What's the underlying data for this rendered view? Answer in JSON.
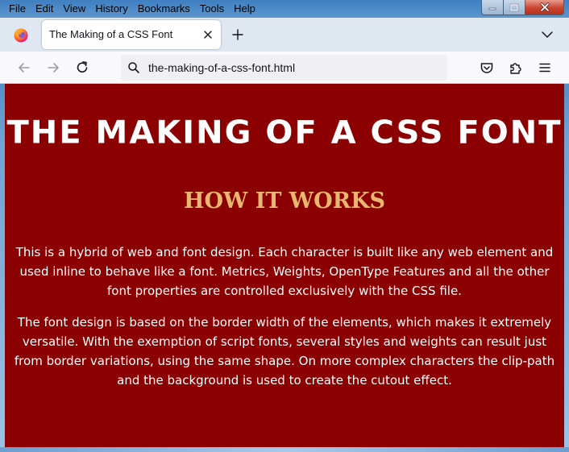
{
  "menu": {
    "items": [
      "File",
      "Edit",
      "View",
      "History",
      "Bookmarks",
      "Tools",
      "Help"
    ]
  },
  "window_controls": {
    "minimize_icon": "minimize-icon",
    "maximize_icon": "maximize-icon",
    "close_icon": "close-icon"
  },
  "tab": {
    "title": "The Making of a CSS Font",
    "close_icon": "close-icon"
  },
  "toolbar": {
    "new_tab_icon": "plus-icon",
    "list_all_tabs_icon": "chevron-down-icon",
    "back_icon": "arrow-left-icon",
    "forward_icon": "arrow-right-icon",
    "reload_icon": "reload-icon",
    "pocket_icon": "pocket-icon",
    "extensions_icon": "puzzle-icon",
    "menu_icon": "hamburger-icon"
  },
  "urlbar": {
    "value": "the-making-of-a-css-font.html",
    "icon": "search-icon"
  },
  "page": {
    "title": "THE MAKING OF A CSS FONT",
    "subtitle": "HOW IT WORKS",
    "paragraph1": "This is a hybrid of web and font design. Each character is built like any web element and used inline to behave like a font. Metrics, Weights, OpenType Features and all the other font properties are controlled exclusively with the CSS file.",
    "paragraph2": "The font design is based on the border width of the elements, which makes it extremely versatile. With the exemption of script fonts, several styles and weights can result just from border variations, using the same shape. On more complex characters the clip-path and the background is used to create the cutout effect."
  },
  "colors": {
    "page_background": "#8b0000",
    "subtitle": "#e8b870",
    "text": "#ffffff"
  }
}
